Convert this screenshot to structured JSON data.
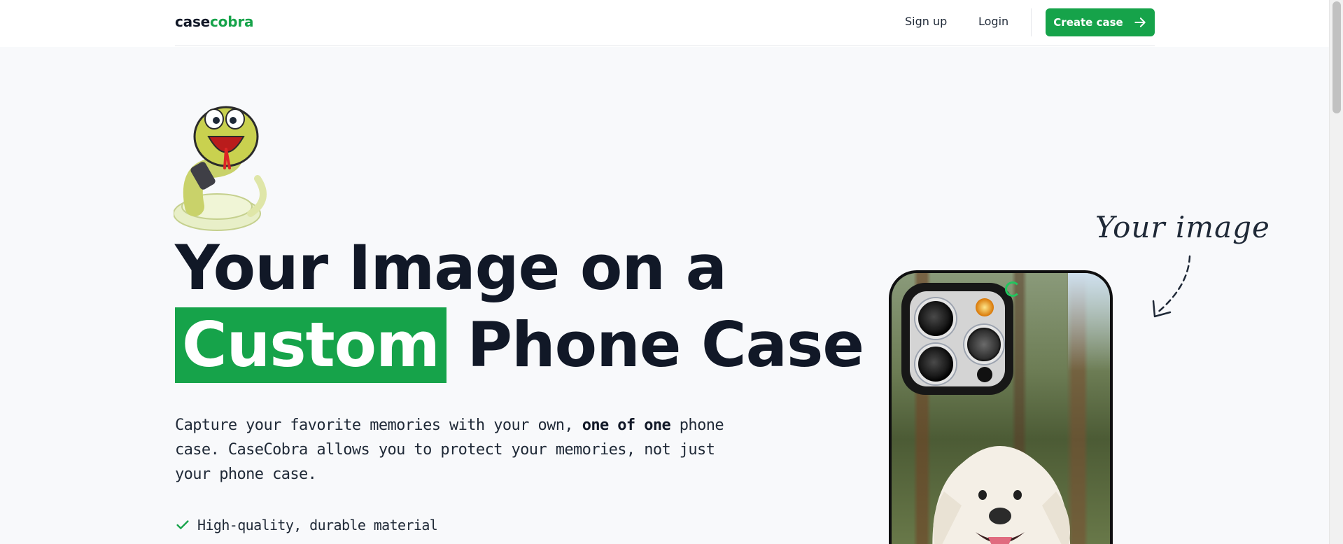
{
  "navbar": {
    "logo_part1": "case",
    "logo_part2": "cobra",
    "signup": "Sign up",
    "login": "Login",
    "create_case": "Create case",
    "accent": "#16a34a"
  },
  "hero": {
    "headline_line1": "Your Image on a",
    "headline_highlight": "Custom",
    "headline_line2_rest": "Phone Case",
    "sub_part1": "Capture your favorite memories with your own, ",
    "sub_bold": "one of one",
    "sub_part2": " phone case. CaseCobra allows you to protect your memories, not just your phone case.",
    "features": [
      "High-quality, durable material"
    ]
  },
  "annotation": {
    "your_image": "Your image"
  },
  "icons": {
    "arrow_right": "arrow-right-icon",
    "check": "check-icon"
  }
}
